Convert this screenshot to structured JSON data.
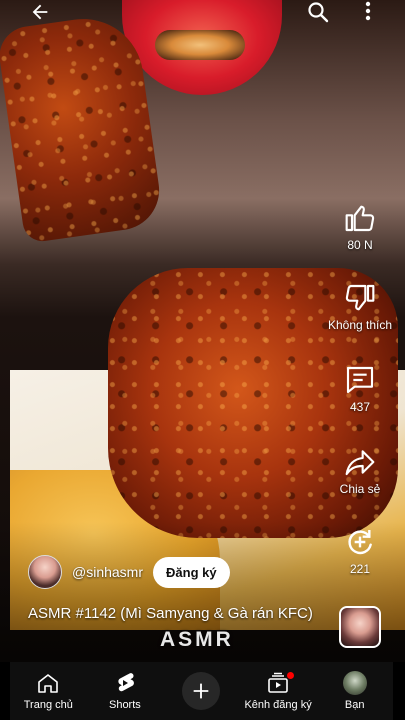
{
  "topbar": {
    "back_icon": "arrow-left-icon",
    "search_icon": "search-icon",
    "more_icon": "more-vert-icon"
  },
  "actions": {
    "like": {
      "icon": "thumb-up-icon",
      "label": "80 N"
    },
    "dislike": {
      "icon": "thumb-down-icon",
      "label": "Không thích"
    },
    "comments": {
      "icon": "comment-icon",
      "label": "437"
    },
    "share": {
      "icon": "share-icon",
      "label": "Chia sẻ"
    },
    "remix": {
      "icon": "remix-icon",
      "label": "221"
    }
  },
  "channel": {
    "handle": "@sinhasmr",
    "subscribe_label": "Đăng ký"
  },
  "video": {
    "title": "ASMR #1142 (Mì Samyang & Gà rán KFC)",
    "watermark": "ASMR"
  },
  "navbar": {
    "items": [
      {
        "icon": "home-icon",
        "label": "Trang chủ"
      },
      {
        "icon": "shorts-icon",
        "label": "Shorts"
      },
      {
        "icon": "plus-icon",
        "label": ""
      },
      {
        "icon": "subscriptions-icon",
        "label": "Kênh đăng ký"
      },
      {
        "icon": "avatar-icon",
        "label": "Bạn"
      }
    ]
  },
  "colors": {
    "navbar_bg": "#0f0f0f",
    "badge": "#ff0000",
    "subscribe_bg": "#ffffff"
  }
}
